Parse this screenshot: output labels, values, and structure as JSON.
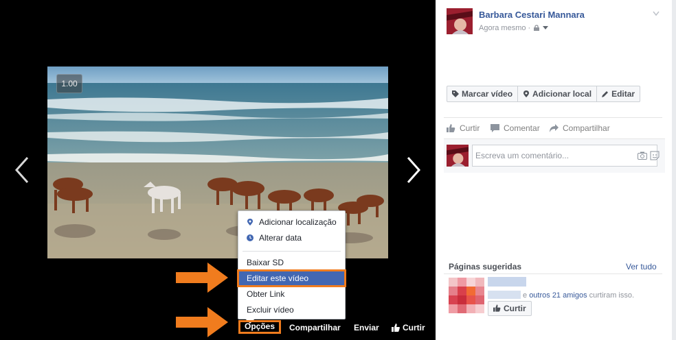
{
  "viewer": {
    "video_badge": "1.00",
    "options_menu": {
      "items_group1": [
        {
          "label": "Adicionar localização",
          "icon": "location-pin-icon"
        },
        {
          "label": "Alterar data",
          "icon": "clock-icon"
        }
      ],
      "items_group2": [
        {
          "label": "Baixar SD"
        },
        {
          "label": "Editar este vídeo",
          "highlighted": true
        },
        {
          "label": "Obter Link"
        },
        {
          "label": "Excluir vídeo"
        }
      ]
    },
    "bottom_bar": {
      "options": "Opções",
      "share": "Compartilhar",
      "send": "Enviar",
      "like": "Curtir"
    },
    "colors": {
      "highlight": "#4267b2",
      "annotation_orange": "#f07c1e"
    }
  },
  "post": {
    "author": "Barbara Cestari Mannara",
    "time": "Agora mesmo",
    "separator": "·",
    "tag_buttons": [
      "Marcar vídeo",
      "Adicionar local",
      "Editar"
    ],
    "actions": {
      "like": "Curtir",
      "comment": "Comentar",
      "share": "Compartilhar"
    },
    "comment_placeholder": "Escreva um comentário..."
  },
  "suggested": {
    "title": "Páginas sugeridas",
    "see_all": "Ver tudo",
    "friends_link": "outros 21 amigos",
    "friends_prefix": "e",
    "friends_suffix": "curtiram isso.",
    "like_button": "Curtir"
  }
}
